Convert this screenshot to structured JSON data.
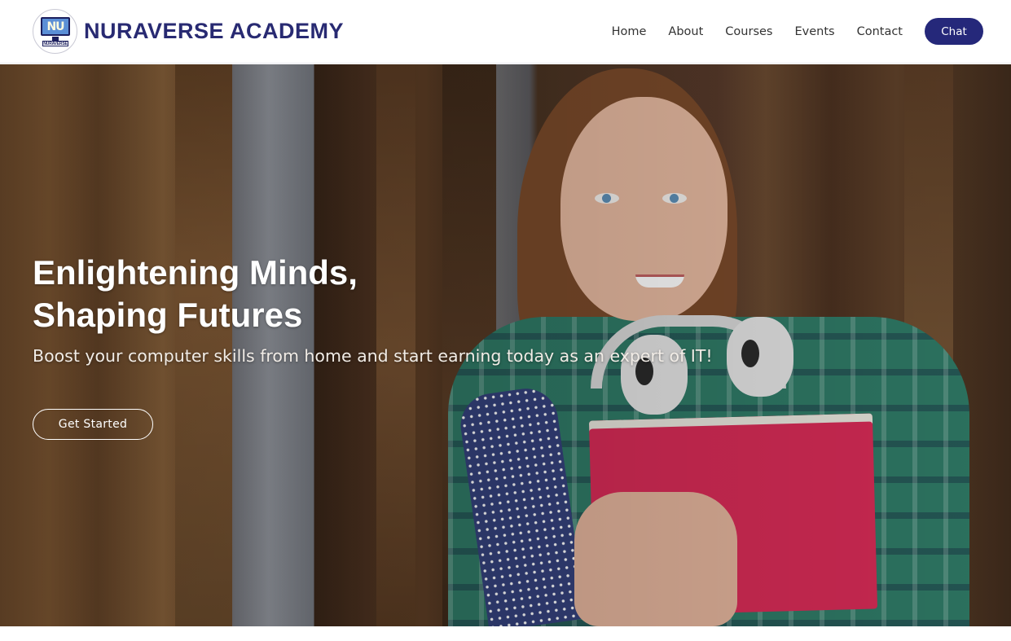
{
  "brand": {
    "name": "NURAVERSE ACADEMY",
    "logo_monogram": "NU",
    "logo_caption": "NURAVERSE",
    "color": "#282a72"
  },
  "nav": {
    "items": [
      {
        "label": "Home"
      },
      {
        "label": "About"
      },
      {
        "label": "Courses"
      },
      {
        "label": "Events"
      },
      {
        "label": "Contact"
      }
    ],
    "chat_label": "Chat",
    "chat_color": "#25287a"
  },
  "hero": {
    "title_line1": "Enlightening Minds,",
    "title_line2": "Shaping Futures",
    "subtitle": "Boost your computer skills from home and start earning today as an expert of IT!",
    "cta_label": "Get Started",
    "image_semantic": "student-holding-folder-photo"
  }
}
